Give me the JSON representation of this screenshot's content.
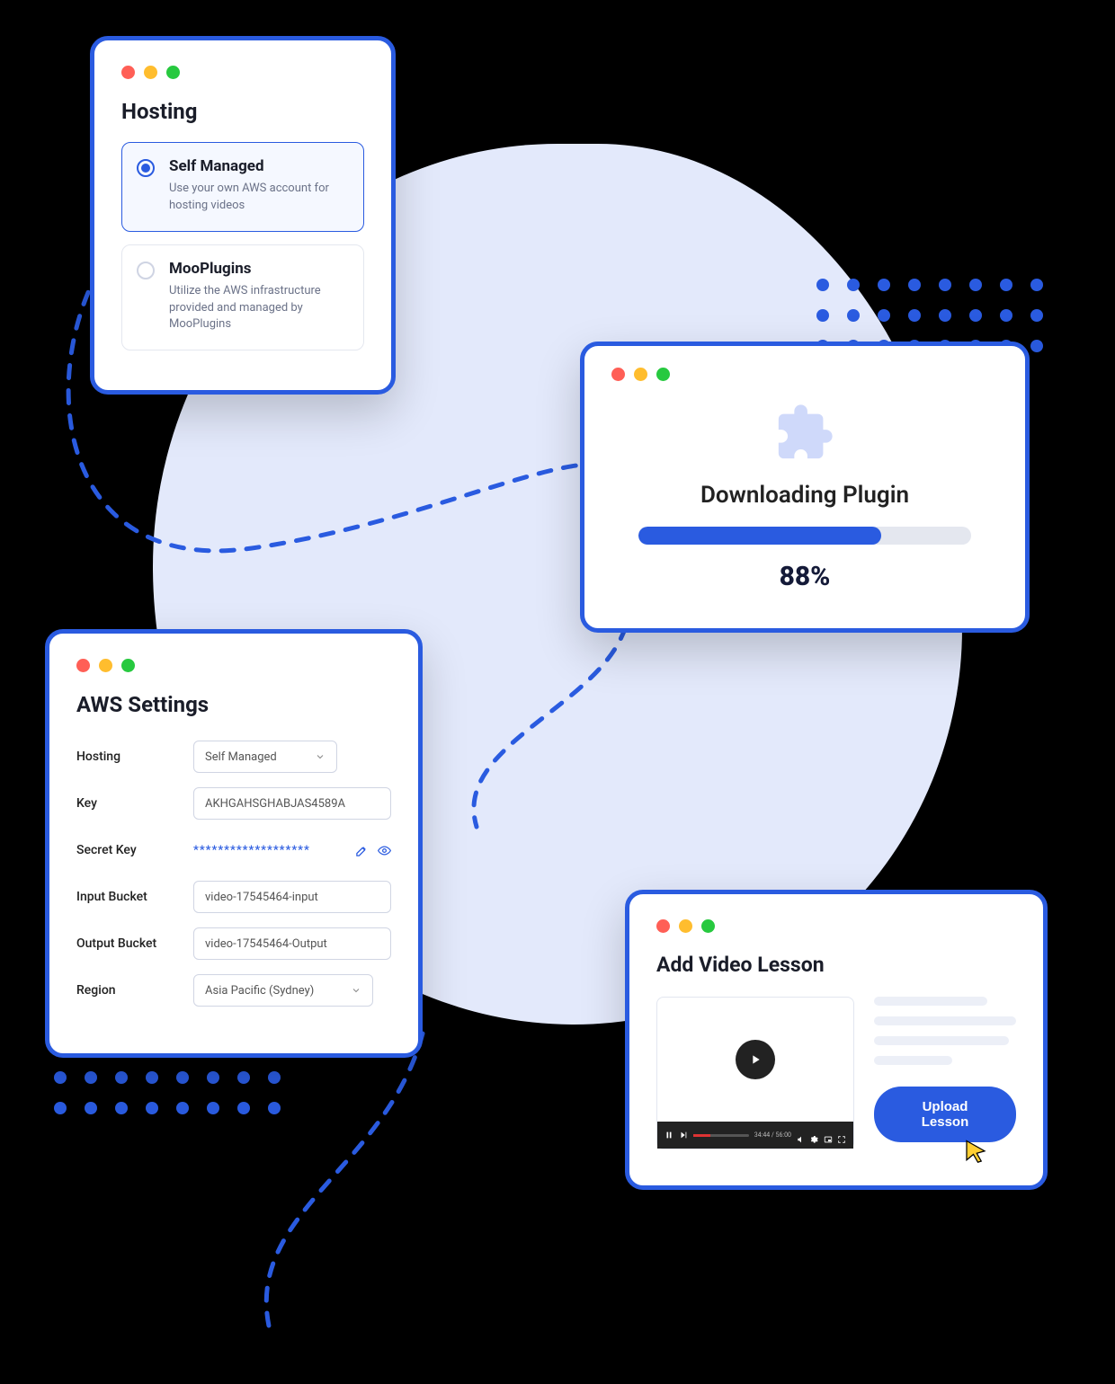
{
  "hosting": {
    "title": "Hosting",
    "options": [
      {
        "title": "Self Managed",
        "desc": "Use your own AWS account for hosting videos"
      },
      {
        "title": "MooPlugins",
        "desc": "Utilize the AWS infrastructure provided and managed by MooPlugins"
      }
    ]
  },
  "download": {
    "title": "Downloading Plugin",
    "percent_value": 88,
    "percent_label": "88%"
  },
  "aws": {
    "title": "AWS Settings",
    "labels": {
      "hosting": "Hosting",
      "key": "Key",
      "secret": "Secret Key",
      "input_bucket": "Input Bucket",
      "output_bucket": "Output Bucket",
      "region": "Region"
    },
    "values": {
      "hosting": "Self Managed",
      "key": "AKHGAHSGHABJAS4589A",
      "secret": "*******************",
      "input_bucket": "video-17545464-input",
      "output_bucket": "video-17545464-Output",
      "region": "Asia Pacific (Sydney)"
    }
  },
  "video": {
    "title": "Add Video Lesson",
    "upload_label": "Upload Lesson",
    "player_time": "34:44 / 56:00"
  }
}
